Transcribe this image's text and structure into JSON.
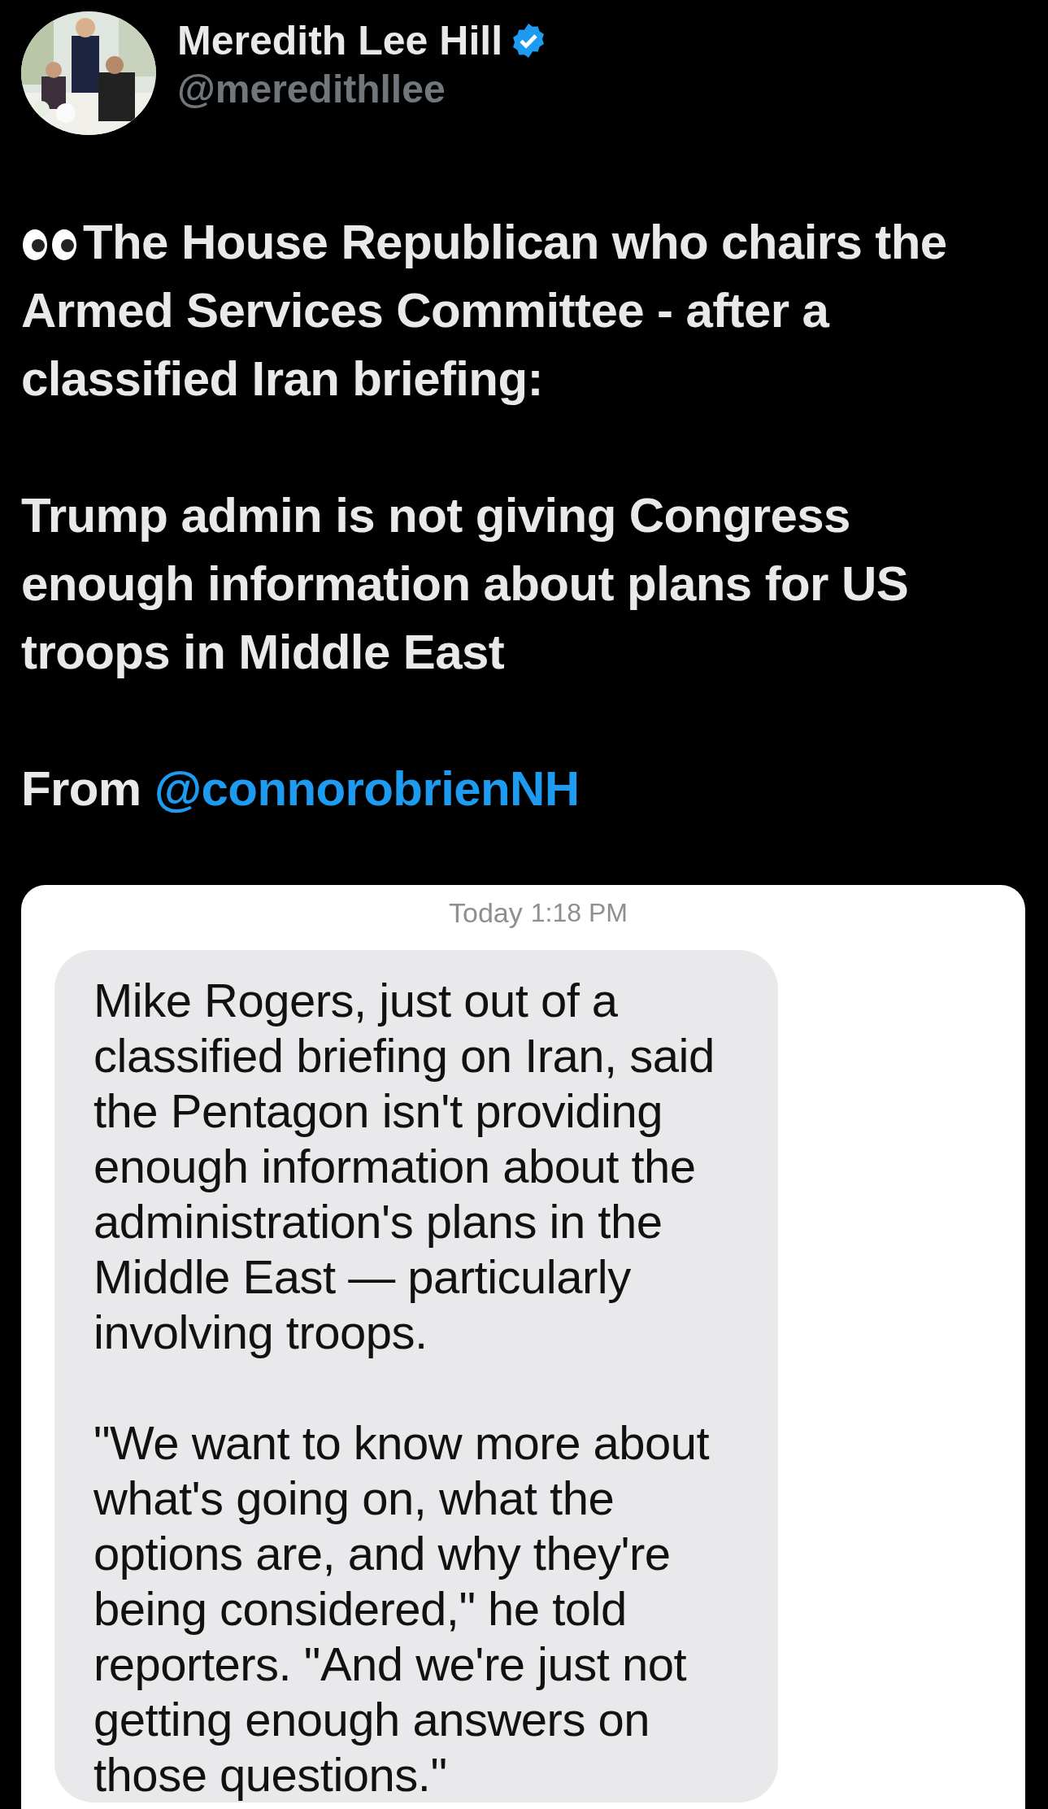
{
  "author": {
    "name": "Meredith Lee Hill",
    "verified": true,
    "handle": "@meredithllee"
  },
  "tweet": {
    "paragraphs": [
      {
        "eyes_emoji": true,
        "text": "The House Republican who chairs the Armed Services Committee - after a classified Iran briefing:"
      },
      {
        "eyes_emoji": false,
        "text": "Trump admin is not giving Congress enough information about plans for US troops in Middle East"
      },
      {
        "eyes_emoji": false,
        "text": "From",
        "mention": "@connorobrienNH"
      }
    ]
  },
  "message_screenshot": {
    "timestamp_day": "Today",
    "timestamp_time": "1:18 PM",
    "bubble": [
      "Mike Rogers, just out of a classified briefing on Iran, said the Pentagon isn't providing enough information about the administration's plans in the Middle East — particularly involving troops.",
      "\"We want to know more about what's going on, what the options are, and why they're being considered,\" he told reporters. \"And we're just not getting enough answers on those questions.\""
    ]
  }
}
